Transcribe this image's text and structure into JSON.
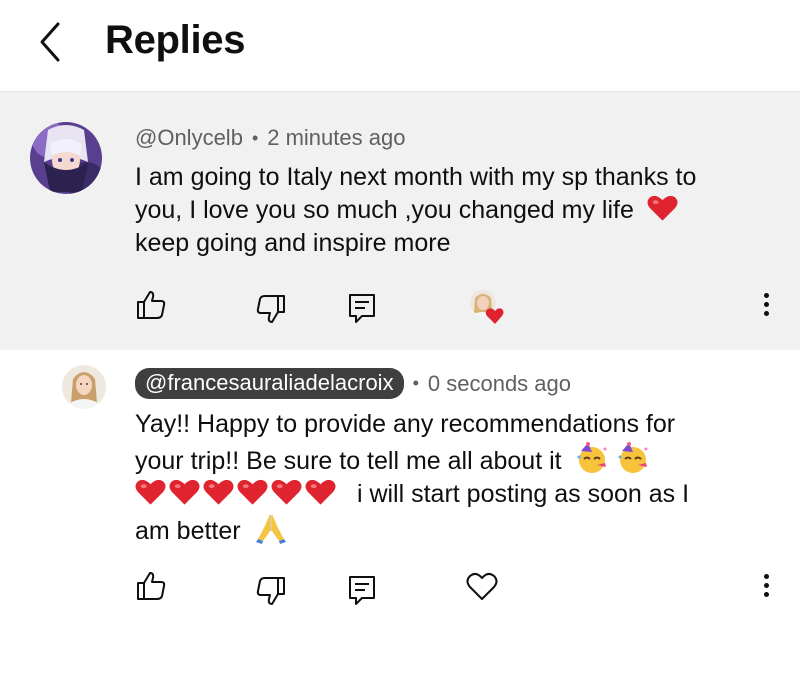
{
  "header": {
    "title": "Replies"
  },
  "comment": {
    "handle": "@Onlycelb",
    "separator": "•",
    "timestamp": "2 minutes ago",
    "text_line1": "I am going to Italy next month with my sp thanks to",
    "text_line2": "you, I love you so much ,you changed my life",
    "text_line3": "keep going and inspire more",
    "icons": [
      "like-icon",
      "dislike-icon",
      "reply-icon",
      "creator-heart-icon",
      "more-icon"
    ]
  },
  "reply": {
    "handle": "@francesauraliadelacroix",
    "separator": "•",
    "timestamp": "0 seconds ago",
    "text_line1": "Yay!! Happy to provide any recommendations for",
    "text_line2": "your trip!! Be sure to tell me all about it",
    "text_line3": "i will start posting as soon as I",
    "text_line4": "am better",
    "icons": [
      "like-icon",
      "dislike-icon",
      "reply-icon",
      "heart-outline-icon",
      "more-icon"
    ]
  },
  "colors": {
    "heart_red": "#e0242f",
    "highlight_bg": "#f1f1f1",
    "pill_bg": "#3f3f3f"
  }
}
